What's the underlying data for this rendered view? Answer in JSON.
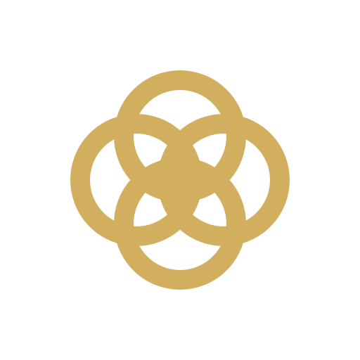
{
  "background_color": "#ffffff",
  "logo": {
    "icon": "four-circle-knot-emblem-icon",
    "color": "#d1af5e",
    "center_mark": "square"
  }
}
